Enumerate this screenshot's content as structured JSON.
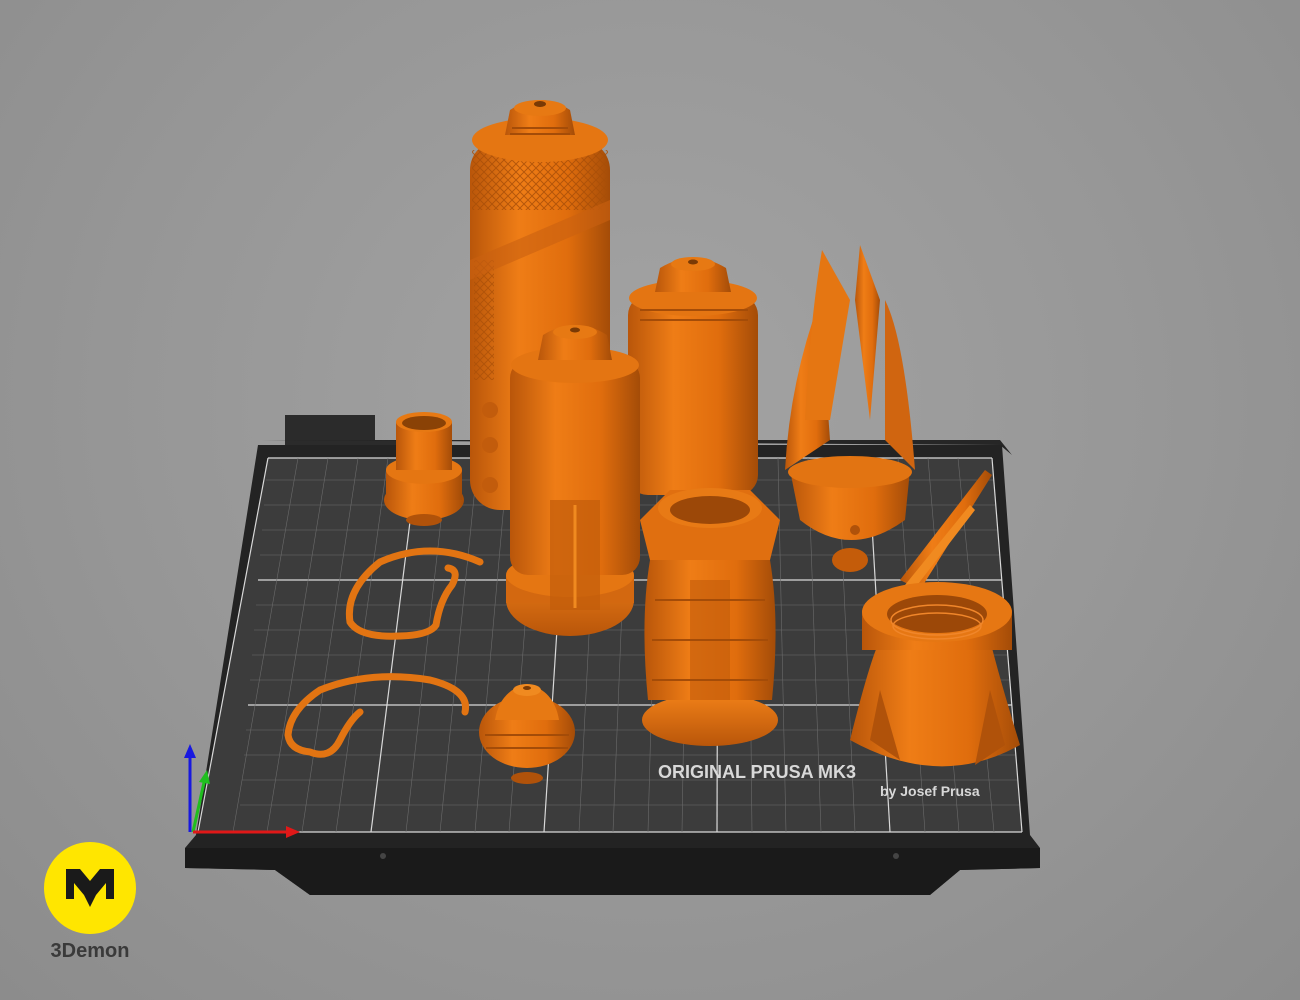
{
  "bed": {
    "model_line1": "ORIGINAL PRUSA MK3",
    "model_line2": "by Josef Prusa"
  },
  "brand": {
    "name": "3Demon"
  },
  "colors": {
    "background": "#9a9a9a",
    "bed_surface": "#3a3a3a",
    "bed_grid": "#cfcfcf",
    "bed_frame": "#1e1e1e",
    "part_orange": "#e0720f",
    "axis_x": "#e01818",
    "axis_y": "#1fbf1f",
    "axis_z": "#1818e0",
    "logo_yellow": "#ffe600"
  },
  "icons": [
    "axis-gizmo-icon",
    "3demon-logo-icon"
  ]
}
